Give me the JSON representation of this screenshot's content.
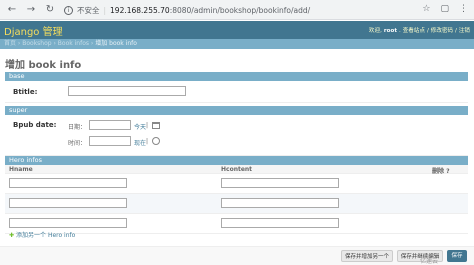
{
  "browser": {
    "security_label": "不安全",
    "host": "192.168.255.70",
    "path": ":8080/admin/bookshop/bookinfo/add/"
  },
  "header": {
    "brand": "Django 管理",
    "welcome": "欢迎,",
    "user": "root",
    "links": ". 查看站点 / 修改密码 / 注销"
  },
  "breadcrumbs": {
    "home": "首页",
    "app": "Bookshop",
    "model": "Book infos",
    "current": "增加 book info"
  },
  "title": "增加 book info",
  "base": {
    "caption": "base",
    "btitle_label": "Btitle:",
    "btitle_value": ""
  },
  "super": {
    "caption": "super",
    "bpub_label": "Bpub date:",
    "date_label": "日期：",
    "date_value": "",
    "today_link": "今天",
    "time_label": "时间：",
    "time_value": "",
    "now_link": "现在"
  },
  "hero": {
    "caption": "Hero infos",
    "columns": [
      "Hname",
      "Hcontent",
      "删除 ?"
    ],
    "rows": [
      {
        "hname": "",
        "hcontent": ""
      },
      {
        "hname": "",
        "hcontent": ""
      },
      {
        "hname": "",
        "hcontent": ""
      }
    ],
    "add_another": "添加另一个 Hero info"
  },
  "submit": {
    "save_add_another": "保存并增加另一个",
    "save_continue": "保存并继续编辑",
    "save": "保存"
  },
  "watermark": "亿速云"
}
